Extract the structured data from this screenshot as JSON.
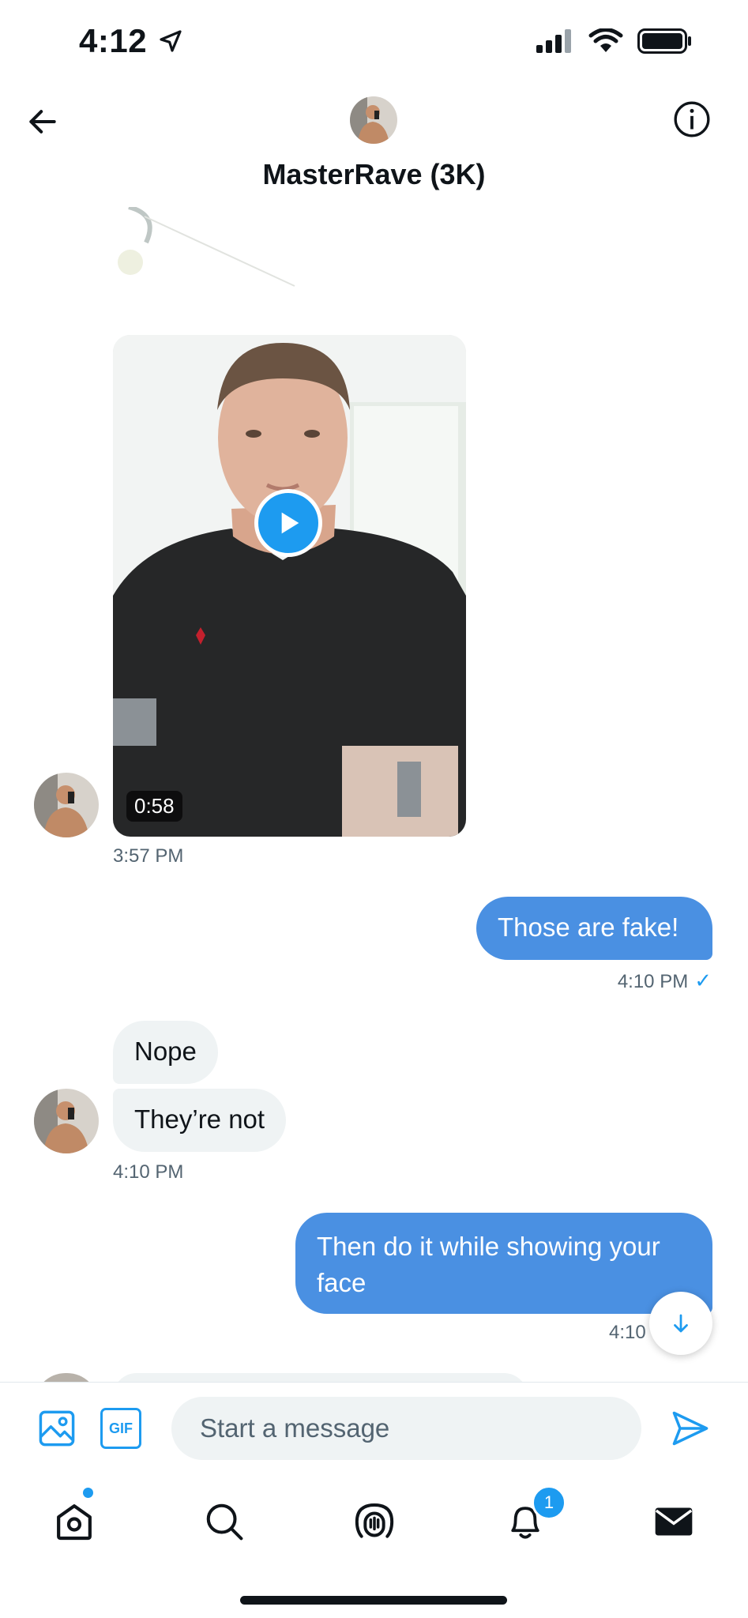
{
  "status_bar": {
    "time": "4:12",
    "icons": [
      "location-arrow-icon",
      "signal-icon",
      "wifi-icon",
      "battery-icon"
    ]
  },
  "header": {
    "title": "MasterRave (3K)",
    "back_icon": "arrow-left-icon",
    "info_icon": "info-icon"
  },
  "messages": [
    {
      "type": "video",
      "direction": "in",
      "duration": "0:58",
      "timestamp": "3:57 PM"
    },
    {
      "type": "text",
      "direction": "out",
      "text": "Those are fake!",
      "timestamp": "4:10 PM",
      "read_icon": "✓"
    },
    {
      "type": "text",
      "direction": "in",
      "text": "Nope"
    },
    {
      "type": "text",
      "direction": "in",
      "text": "They’re not",
      "timestamp": "4:10 PM"
    },
    {
      "type": "text",
      "direction": "out",
      "text_line1": "Then do it while showing your",
      "text_line2": "face",
      "timestamp": "4:10"
    }
  ],
  "composer": {
    "placeholder": "Start a message",
    "gif_label": "GIF"
  },
  "tabbar": {
    "items": [
      "home-icon",
      "search-icon",
      "spaces-icon",
      "notifications-icon",
      "messages-icon"
    ],
    "notifications_badge": "1"
  },
  "colors": {
    "accent": "#1d9bf0",
    "bubble_out": "#4a90e2",
    "bubble_in": "#eff3f4",
    "secondary_text": "#536471"
  }
}
